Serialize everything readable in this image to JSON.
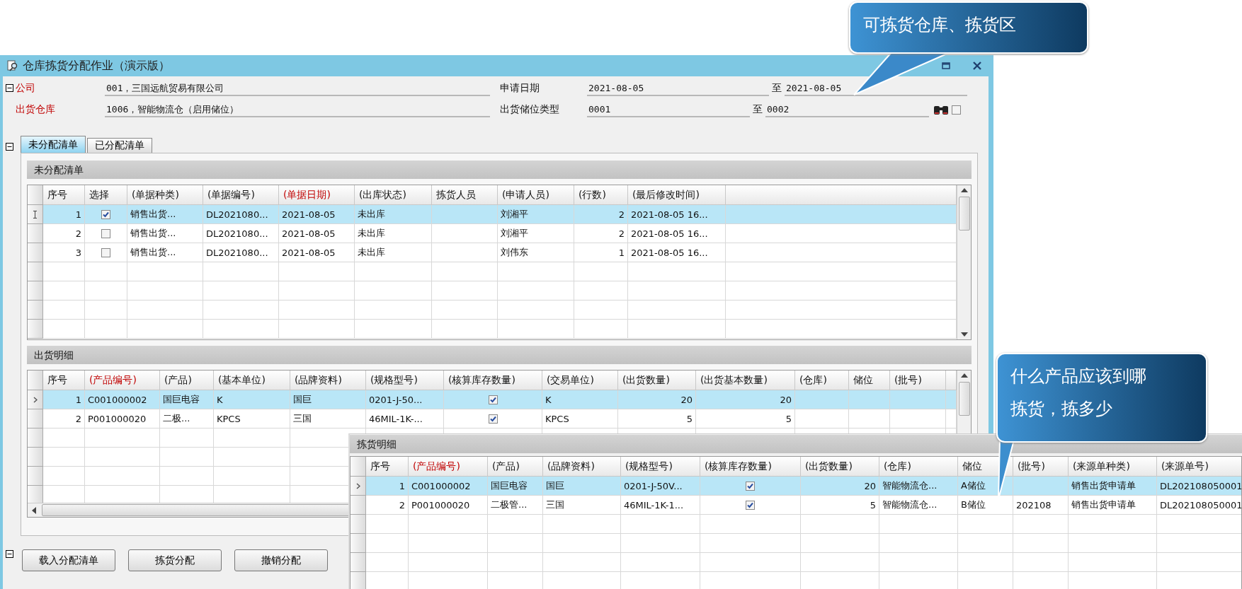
{
  "window": {
    "title": "仓库拣货分配作业（演示版）"
  },
  "callouts": [
    {
      "lines": [
        "可拣货仓库、拣货区"
      ]
    },
    {
      "lines": [
        "什么产品应该到哪",
        "拣货，拣多少"
      ]
    }
  ],
  "form": {
    "rows": [
      {
        "label": "公司",
        "required": true,
        "value": "001，三国远航贸易有限公司",
        "range_label": "申请日期",
        "from": "2021-08-05",
        "to_label": "至",
        "to": "2021-08-05"
      },
      {
        "label": "出货仓库",
        "required": true,
        "value": "1006，智能物流仓（启用储位）",
        "range_label": "出货储位类型",
        "from": "0001",
        "to_label": "至",
        "to": "0002",
        "option_checked": false
      }
    ]
  },
  "tabs": [
    {
      "label": "未分配清单",
      "selected": true
    },
    {
      "label": "已分配清单",
      "selected": false
    }
  ],
  "grids": [
    {
      "title": "未分配清单",
      "columns": [
        {
          "label": "序号",
          "kind": "number",
          "required": false
        },
        {
          "label": "选择",
          "kind": "check",
          "required": false
        },
        {
          "label": "(单据种类)",
          "kind": "text",
          "required": false
        },
        {
          "label": "(单据编号)",
          "kind": "text",
          "required": false
        },
        {
          "label": "(单据日期)",
          "kind": "text",
          "required": true
        },
        {
          "label": "(出库状态)",
          "kind": "text",
          "required": false
        },
        {
          "label": "拣货人员",
          "kind": "text",
          "required": false
        },
        {
          "label": "(申请人员)",
          "kind": "text",
          "required": false
        },
        {
          "label": "(行数)",
          "kind": "number",
          "required": false
        },
        {
          "label": "(最后修改时间)",
          "kind": "text",
          "required": false
        }
      ],
      "rows": [
        {
          "selected": true,
          "cells": [
            "1",
            {
              "checked": true
            },
            "销售出货...",
            "DL2021080...",
            "2021-08-05",
            "未出库",
            null,
            "刘湘平",
            "2",
            "2021-08-05 16..."
          ]
        },
        {
          "selected": false,
          "cells": [
            "2",
            {
              "checked": false
            },
            "销售出货...",
            "DL2021080...",
            "2021-08-05",
            "未出库",
            null,
            "刘湘平",
            "2",
            "2021-08-05 16..."
          ]
        },
        {
          "selected": false,
          "cells": [
            "3",
            {
              "checked": false
            },
            "销售出货...",
            "DL2021080...",
            "2021-08-05",
            "未出库",
            null,
            "刘伟东",
            "1",
            "2021-08-05 16..."
          ]
        }
      ]
    },
    {
      "title": "出货明细",
      "columns": [
        {
          "label": "序号",
          "kind": "number",
          "required": false
        },
        {
          "label": "(产品编号)",
          "kind": "text",
          "required": true
        },
        {
          "label": "(产品)",
          "kind": "text",
          "required": false
        },
        {
          "label": "(基本单位)",
          "kind": "text",
          "required": false
        },
        {
          "label": "(品牌资料)",
          "kind": "text",
          "required": false
        },
        {
          "label": "(规格型号)",
          "kind": "text",
          "required": false
        },
        {
          "label": "(核算库存数量)",
          "kind": "check",
          "required": false
        },
        {
          "label": "(交易单位)",
          "kind": "text",
          "required": false
        },
        {
          "label": "(出货数量)",
          "kind": "number",
          "required": false
        },
        {
          "label": "(出货基本数量)",
          "kind": "number",
          "required": false
        },
        {
          "label": "(仓库)",
          "kind": "text",
          "required": false
        },
        {
          "label": "储位",
          "kind": "text",
          "required": false
        },
        {
          "label": "(批号)",
          "kind": "text",
          "required": false
        }
      ],
      "rows": [
        {
          "selected": true,
          "cells": [
            "1",
            "C001000002",
            "国巨电容",
            "K",
            "国巨",
            "0201-J-50...",
            {
              "checked": true
            },
            "K",
            "20",
            "20",
            null,
            null,
            null
          ]
        },
        {
          "selected": false,
          "cells": [
            "2",
            "P001000020",
            "二极...",
            "KPCS",
            "三国",
            "46MIL-1K-...",
            {
              "checked": true
            },
            "KPCS",
            "5",
            "5",
            null,
            null,
            null
          ]
        }
      ]
    },
    {
      "title": "拣货明细",
      "columns": [
        {
          "label": "序号",
          "kind": "number",
          "required": false
        },
        {
          "label": "(产品编号)",
          "kind": "text",
          "required": true
        },
        {
          "label": "(产品)",
          "kind": "text",
          "required": false
        },
        {
          "label": "(品牌资料)",
          "kind": "text",
          "required": false
        },
        {
          "label": "(规格型号)",
          "kind": "text",
          "required": false
        },
        {
          "label": "(核算库存数量)",
          "kind": "check",
          "required": false
        },
        {
          "label": "(出货数量)",
          "kind": "number",
          "required": false
        },
        {
          "label": "(仓库)",
          "kind": "text",
          "required": false
        },
        {
          "label": "储位",
          "kind": "text",
          "required": false
        },
        {
          "label": "(批号)",
          "kind": "text",
          "required": false
        },
        {
          "label": "(来源单种类)",
          "kind": "text",
          "required": false
        },
        {
          "label": "(来源单号)",
          "kind": "text",
          "required": false
        }
      ],
      "rows": [
        {
          "selected": true,
          "cells": [
            "1",
            "C001000002",
            "国巨电容",
            "国巨",
            "0201-J-50V...",
            {
              "checked": true
            },
            "20",
            "智能物流仓...",
            "A储位",
            null,
            "销售出货申请单",
            "DL202108050001"
          ]
        },
        {
          "selected": false,
          "cells": [
            "2",
            "P001000020",
            "二极管...",
            "三国",
            "46MIL-1K-1...",
            {
              "checked": true
            },
            "5",
            "智能物流仓...",
            "B储位",
            "202108",
            "销售出货申请单",
            "DL202108050001"
          ]
        }
      ]
    }
  ],
  "buttons": [
    "载入分配清单",
    "拣货分配",
    "撤销分配"
  ]
}
